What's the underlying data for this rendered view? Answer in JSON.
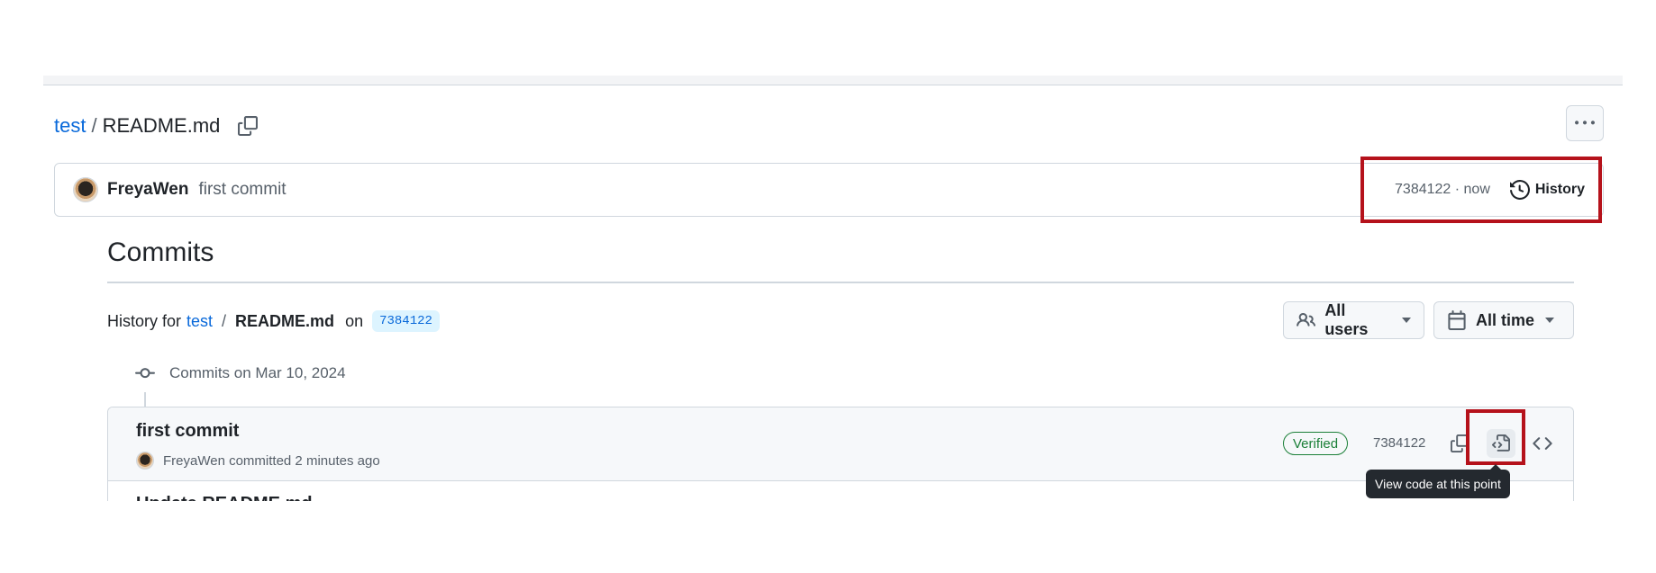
{
  "breadcrumb": {
    "repo": "test",
    "separator": "/",
    "file": "README.md"
  },
  "icons": {
    "copy": "copy-icon",
    "more": "kebab-horizontal-icon",
    "history": "history-icon",
    "people": "people-icon",
    "calendar": "calendar-icon",
    "commit": "git-commit-icon",
    "file_code": "file-code-icon",
    "code": "code-icon"
  },
  "latest_commit": {
    "author": "FreyaWen",
    "message": "first commit",
    "sha_time": "7384122 · now",
    "history_label": "History"
  },
  "commits_page": {
    "title": "Commits",
    "history_for_label": "History for",
    "repo_link": "test",
    "slash": "/",
    "file": "README.md",
    "on_label": "on",
    "sha": "7384122"
  },
  "filters": {
    "users": "All users",
    "time": "All time"
  },
  "group": {
    "label": "Commits on Mar 10, 2024"
  },
  "commits": [
    {
      "title": "first commit",
      "author": "FreyaWen",
      "byline": "FreyaWen committed 2 minutes ago",
      "verified": "Verified",
      "sha": "7384122"
    }
  ],
  "partial_next_commit": {
    "title": "Update README.md"
  },
  "tooltip": {
    "text": "View code at this point"
  },
  "colors": {
    "link": "#0969da",
    "highlight": "#b5121b",
    "verified": "#1a7f37",
    "tooltip_bg": "#24292f"
  }
}
